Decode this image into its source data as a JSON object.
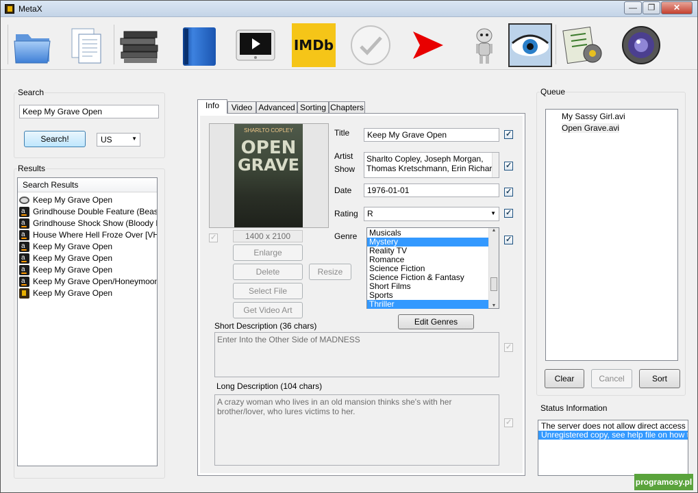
{
  "window": {
    "title": "MetaX",
    "minimize": "—",
    "maximize": "❐",
    "close": "✕"
  },
  "toolbar": {
    "items": [
      {
        "name": "open"
      },
      {
        "name": "documents"
      },
      {
        "name": "batch"
      },
      {
        "name": "book"
      },
      {
        "name": "video"
      },
      {
        "name": "imdb",
        "label": "IMDb"
      },
      {
        "name": "check"
      },
      {
        "name": "go"
      },
      {
        "name": "robot"
      },
      {
        "name": "eye"
      },
      {
        "name": "settings"
      },
      {
        "name": "about"
      }
    ]
  },
  "search": {
    "legend": "Search",
    "query": "Keep My Grave Open",
    "button": "Search!",
    "region": "US"
  },
  "results": {
    "legend": "Results",
    "header": "Search Results",
    "items": [
      {
        "icon": "disc",
        "text": "Keep My Grave Open"
      },
      {
        "icon": "amazon",
        "text": "Grindhouse Double Feature (Beast ..."
      },
      {
        "icon": "amazon",
        "text": "Grindhouse Shock Show (Bloody P..."
      },
      {
        "icon": "amazon",
        "text": "House Where Hell Froze Over [VHS]"
      },
      {
        "icon": "amazon",
        "text": "Keep My Grave Open"
      },
      {
        "icon": "amazon",
        "text": "Keep My Grave Open"
      },
      {
        "icon": "amazon",
        "text": "Keep My Grave Open"
      },
      {
        "icon": "amazon",
        "text": "Keep My Grave Open/Honeymoon..."
      },
      {
        "icon": "metax",
        "text": "Keep My Grave Open"
      }
    ]
  },
  "tabs": [
    "Info",
    "Video",
    "Advanced",
    "Sorting",
    "Chapters"
  ],
  "art": {
    "poster_top": "SHARLTO COPLEY",
    "poster_title1": "OPEN",
    "poster_title2": "GRAVE",
    "size": "1400 x 2100",
    "enlarge": "Enlarge",
    "delete": "Delete",
    "resize": "Resize",
    "select_file": "Select File",
    "get_video_art": "Get Video Art"
  },
  "info": {
    "title_label": "Title",
    "title": "Keep My Grave Open",
    "artist_label": "Artist",
    "show_label": "Show",
    "artist_line1": "Sharlto Copley, Joseph Morgan,",
    "artist_line2": "Thomas Kretschmann, Erin Richards,",
    "date_label": "Date",
    "date": "1976-01-01",
    "rating_label": "Rating",
    "rating": "R",
    "genre_label": "Genre",
    "genres": [
      {
        "text": "Musicals",
        "selected": false
      },
      {
        "text": "Mystery",
        "selected": true
      },
      {
        "text": "Reality TV",
        "selected": false
      },
      {
        "text": "Romance",
        "selected": false
      },
      {
        "text": "Science Fiction",
        "selected": false
      },
      {
        "text": "Science Fiction & Fantasy",
        "selected": false
      },
      {
        "text": "Short Films",
        "selected": false
      },
      {
        "text": "Sports",
        "selected": false
      },
      {
        "text": "Thriller",
        "selected": true
      }
    ],
    "edit_genres": "Edit Genres",
    "short_desc_label": "Short Description (36 chars)",
    "short_desc": "Enter Into the Other Side of MADNESS",
    "long_desc_label": "Long Description (104 chars)",
    "long_desc": "A crazy woman who lives in an old mansion thinks she's with her brother/lover, who lures victims to her."
  },
  "queue": {
    "legend": "Queue",
    "items": [
      {
        "text": "My Sassy Girl.avi",
        "selected": false
      },
      {
        "text": "Open Grave.avi",
        "selected": true
      }
    ],
    "clear": "Clear",
    "cancel": "Cancel",
    "sort": "Sort"
  },
  "status": {
    "legend": "Status Information",
    "lines": [
      {
        "text": "The server does not allow direct access to this",
        "selected": false
      },
      {
        "text": "Unregistered copy, see help file on how to reg",
        "selected": true
      }
    ]
  },
  "watermark": "programosy.pl",
  "colors": {
    "selection": "#3399ff",
    "title_bar": "#c3d4e7",
    "watermark": "#5aa33c"
  }
}
